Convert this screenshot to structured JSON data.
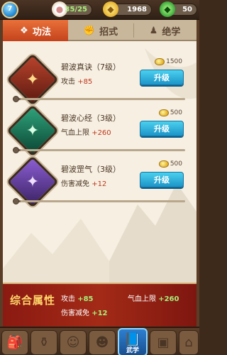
{
  "topbar": {
    "level": "7",
    "resources": [
      {
        "id": "stamina",
        "icon": "steamed-bun-icon",
        "value": "35/25"
      },
      {
        "id": "gold",
        "icon": "gold-ingot-icon",
        "value": "1968"
      },
      {
        "id": "jade",
        "icon": "jade-icon",
        "value": "50"
      }
    ]
  },
  "tabs": [
    {
      "label": "功法",
      "icon": "martial-scroll-icon",
      "active": true
    },
    {
      "label": "招式",
      "icon": "fist-icon",
      "active": false
    },
    {
      "label": "绝学",
      "icon": "master-icon",
      "active": false
    }
  ],
  "skills": [
    {
      "name": "碧波真诀（7级）",
      "icon": "red-book-icon",
      "effect_label": "攻击",
      "effect_value": "+85",
      "cost": "1500",
      "button": "升级",
      "progress": 0.02
    },
    {
      "name": "碧波心经（3级）",
      "icon": "green-book-icon",
      "effect_label": "气血上限",
      "effect_value": "+260",
      "cost": "500",
      "button": "升级",
      "progress": 0.02
    },
    {
      "name": "碧波罡气（3级）",
      "icon": "purple-book-icon",
      "effect_label": "伤害减免",
      "effect_value": "+12",
      "cost": "500",
      "button": "升级",
      "progress": 0.02
    }
  ],
  "summary": {
    "title": "综合属性",
    "attack_label": "攻击",
    "attack_value": "+85",
    "hp_label": "气血上限",
    "hp_value": "+260",
    "reduction_label": "伤害减免",
    "reduction_value": "+12"
  },
  "bottomnav": [
    {
      "icon": "bag-icon",
      "label": ""
    },
    {
      "icon": "treasure-pot-icon",
      "label": ""
    },
    {
      "icon": "hero-icon",
      "label": ""
    },
    {
      "icon": "companion-icon",
      "label": ""
    },
    {
      "icon": "martial-book-icon",
      "label": "武学",
      "active": true
    },
    {
      "icon": "storage-icon",
      "label": ""
    },
    {
      "icon": "shop-icon",
      "label": ""
    }
  ],
  "colors": {
    "accent_tab": "#d8552a",
    "button": "#2aa6d8",
    "summary_bg": "#9a2214",
    "stat_green": "#a8f07a"
  }
}
